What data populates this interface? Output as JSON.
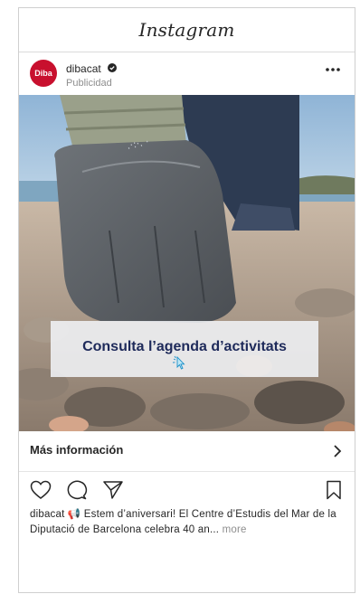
{
  "header": {
    "app_name": "Instagram"
  },
  "post": {
    "avatar_text": "Diba",
    "username": "dibacat",
    "subtitle": "Publicidad",
    "cta_banner": "Consulta l’agenda d’activitats",
    "more_info_label": "Más información",
    "caption_user": "dibacat",
    "caption_text": "📢 Estem d’aniversari! El Centre d’Estudis del Mar de la Diputació de Barcelona celebra 40 an...",
    "caption_more": "more"
  },
  "colors": {
    "brand_red": "#c8102e",
    "banner_text": "#1e2a5a"
  }
}
